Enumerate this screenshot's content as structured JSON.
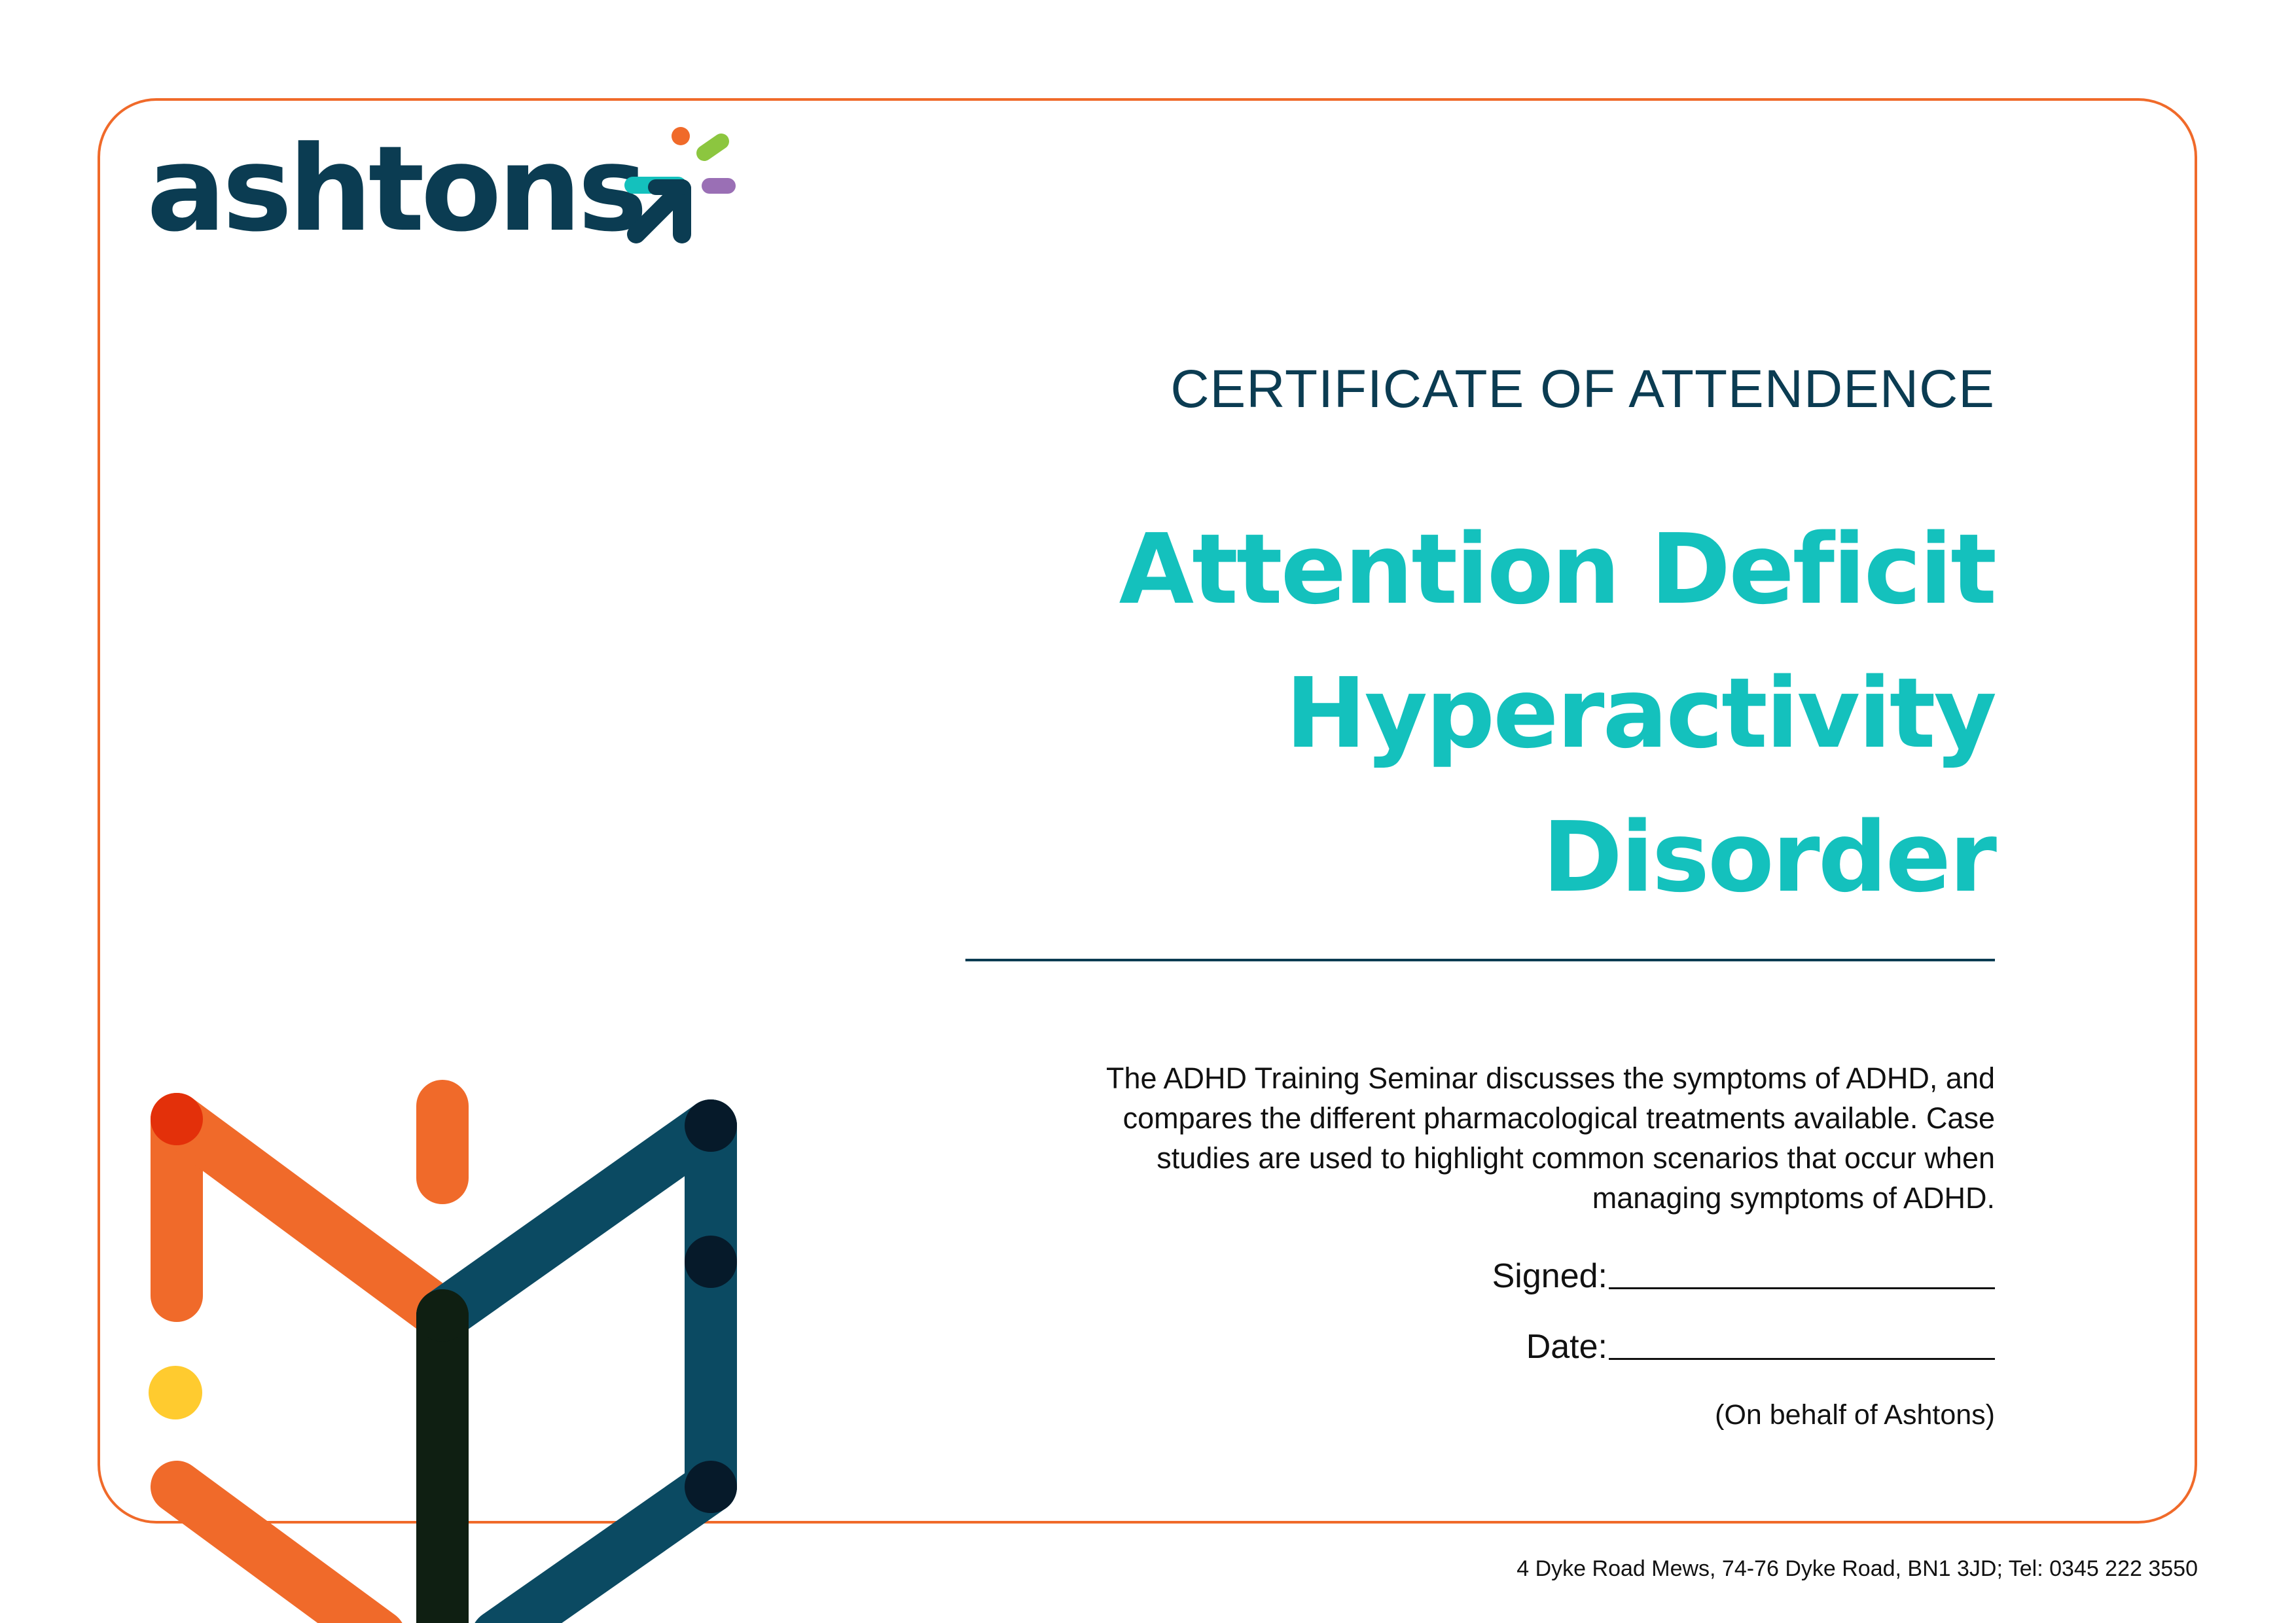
{
  "logo": {
    "wordmark": "ashtons"
  },
  "certificate": {
    "heading": "CERTIFICATE OF ATTENDENCE",
    "course_title_line1": "Attention Deficit",
    "course_title_line2": "Hyperactivity Disorder",
    "description_lines": [
      "The ADHD Training Seminar discusses the symptoms of ADHD, and",
      "compares the different pharmacological treatments available. Case",
      "studies are used to highlight common scenarios that occur when",
      "managing symptoms of ADHD."
    ],
    "signed_label": "Signed:",
    "date_label": "Date:",
    "behalf_note": "(On behalf of Ashtons)"
  },
  "footer": {
    "address": "4 Dyke Road Mews, 74-76 Dyke Road, BN1 3JD; Tel: 0345 222 3550"
  },
  "colors": {
    "frame_orange": "#f06a2a",
    "navy": "#0b3c52",
    "teal": "#14c1bd",
    "purple": "#9a6fb5",
    "lime": "#8cc63f",
    "yellow": "#ffcb2f",
    "red": "#e3300a",
    "dark_green": "#0f1f12"
  }
}
